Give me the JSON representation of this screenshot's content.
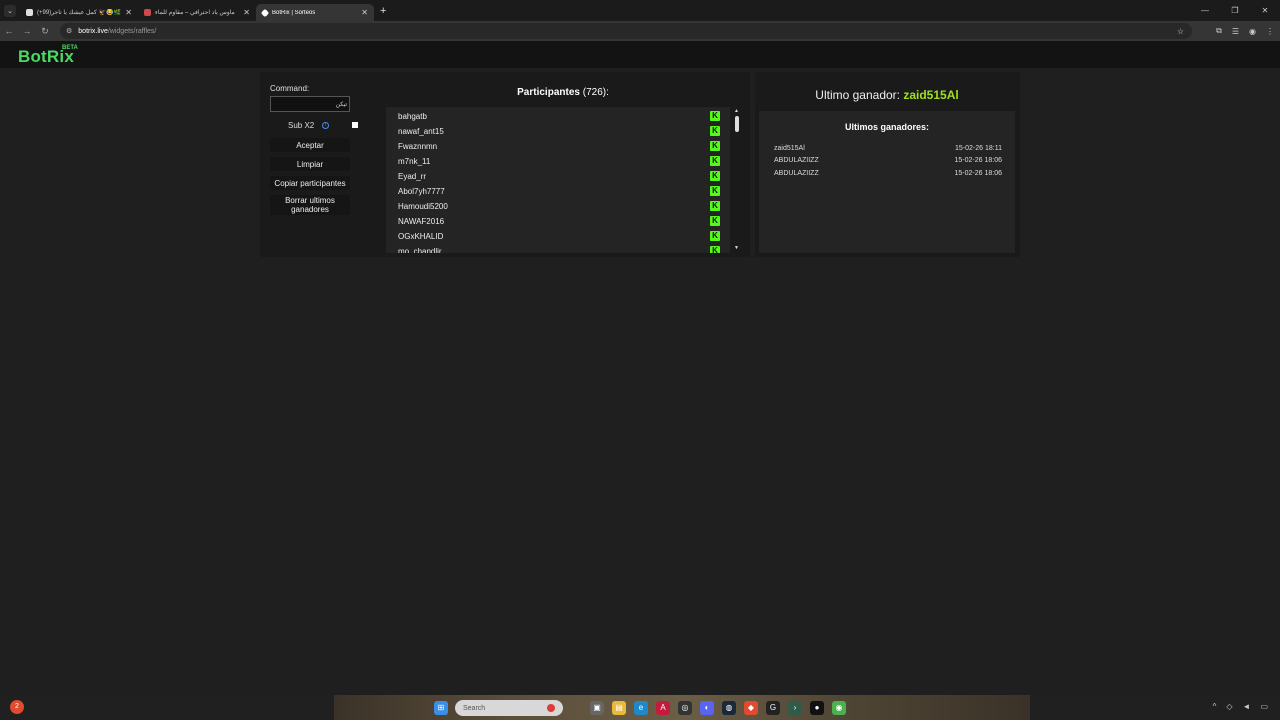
{
  "browser": {
    "tabs": [
      {
        "label": "(+99)كمل عيشك يا تاجر 🦅😂🌿",
        "color": "#e0e0e0"
      },
      {
        "label": "ماوس ياد احترافي – مقاوم للماء",
        "color": "#d04a4a"
      },
      {
        "label": "BotRix | Sorteos",
        "color": "#ffffff"
      }
    ],
    "url_host": "botrix.live",
    "url_path": "/widgets/raffles/"
  },
  "app": {
    "logo": "BotRix",
    "badge": "BETA",
    "accent": "#4cd964"
  },
  "controls": {
    "command_label": "Command:",
    "command_value": "تيكن",
    "sub_label": "Sub X2",
    "info_glyph": "i",
    "accept": "Aceptar",
    "clear": "Limpiar",
    "copy": "Copiar participantes",
    "delete_last": "Borrar ultimos ganadores"
  },
  "participants": {
    "title": "Participantes",
    "count": "(726):",
    "kick_glyph": "K",
    "items": [
      "bahgatb",
      "nawaf_ant15",
      "Fwaznnmn",
      "m7nk_11",
      "Eyad_rr",
      "Abol7yh7777",
      "Hamoudi5200",
      "NAWAF2016",
      "OGxKHALID",
      "mo_chandlir"
    ]
  },
  "winner": {
    "label": "Ultimo ganador:",
    "name": "zaid515Al",
    "name_color": "#9fe020"
  },
  "last_winners": {
    "title": "Ultimos ganadores:",
    "items": [
      {
        "name": "zaid515Al",
        "date": "15-02-26 18:11"
      },
      {
        "name": "ABDULAZIIZZ",
        "date": "15-02-26 18:06"
      },
      {
        "name": "ABDULAZIIZZ",
        "date": "15-02-26 18:06"
      }
    ]
  },
  "taskbar": {
    "search_placeholder": "Search",
    "notif_count": "2"
  }
}
